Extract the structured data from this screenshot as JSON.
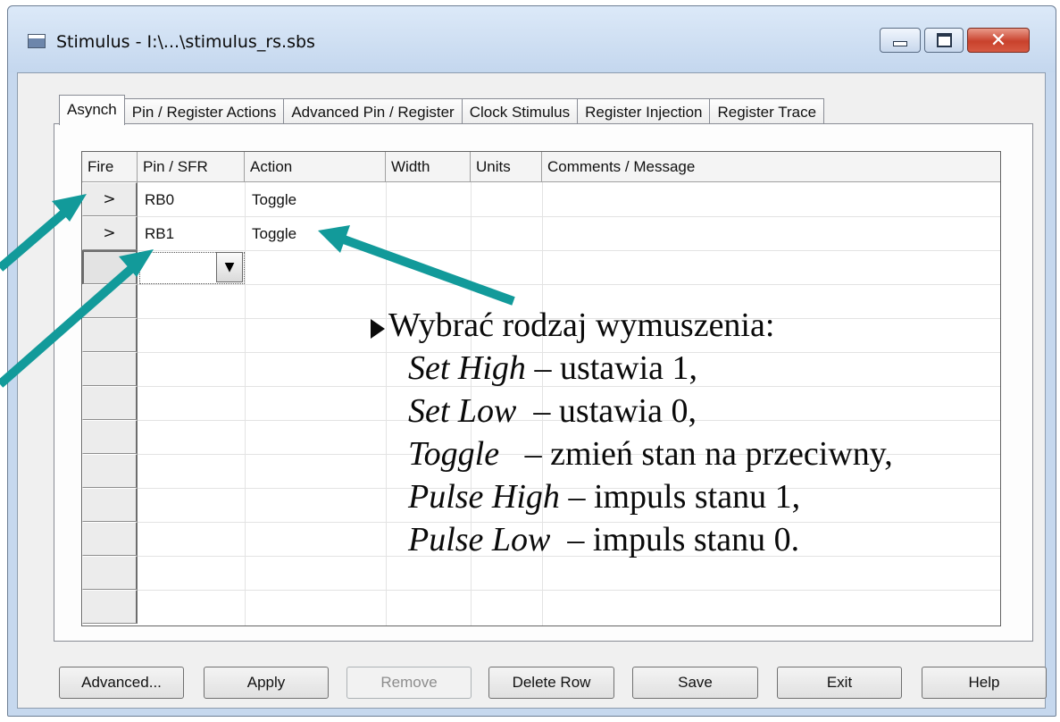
{
  "window": {
    "title": "Stimulus - I:\\...\\stimulus_rs.sbs",
    "controls": {
      "minimize_icon": "minimize-icon",
      "maximize_icon": "maximize-icon",
      "close_icon": "close-icon"
    }
  },
  "tabs": [
    "Asynch",
    "Pin / Register Actions",
    "Advanced Pin / Register",
    "Clock Stimulus",
    "Register Injection",
    "Register Trace"
  ],
  "active_tab": "Asynch",
  "grid": {
    "columns": [
      "Fire",
      "Pin / SFR",
      "Action",
      "Width",
      "Units",
      "Comments / Message"
    ],
    "rows": [
      {
        "fire": ">",
        "pin": "RB0",
        "action": "Toggle",
        "width": "",
        "units": "",
        "comments": ""
      },
      {
        "fire": ">",
        "pin": "RB1",
        "action": "Toggle",
        "width": "",
        "units": "",
        "comments": ""
      }
    ],
    "editing_row_dropdown_icon": "dropdown-arrow-icon"
  },
  "buttons": {
    "advanced": "Advanced...",
    "apply": "Apply",
    "remove": "Remove",
    "delete_row": "Delete Row",
    "save": "Save",
    "exit": "Exit",
    "help": "Help"
  },
  "annotation": {
    "heading": "Wybrać rodzaj wymuszenia:",
    "items": [
      {
        "term": "Set High",
        "desc": " – ustawia 1,"
      },
      {
        "term": "Set Low",
        "desc": "  – ustawia 0,"
      },
      {
        "term": "Toggle",
        "desc": "   – zmień stan na przeciwny,"
      },
      {
        "term": "Pulse High",
        "desc": " – impuls stanu 1,"
      },
      {
        "term": "Pulse Low",
        "desc": "  – impuls stanu 0."
      }
    ]
  },
  "colors": {
    "arrow": "#129a9a",
    "title_bar": "#c4d7ee",
    "close_button": "#c9412c"
  }
}
